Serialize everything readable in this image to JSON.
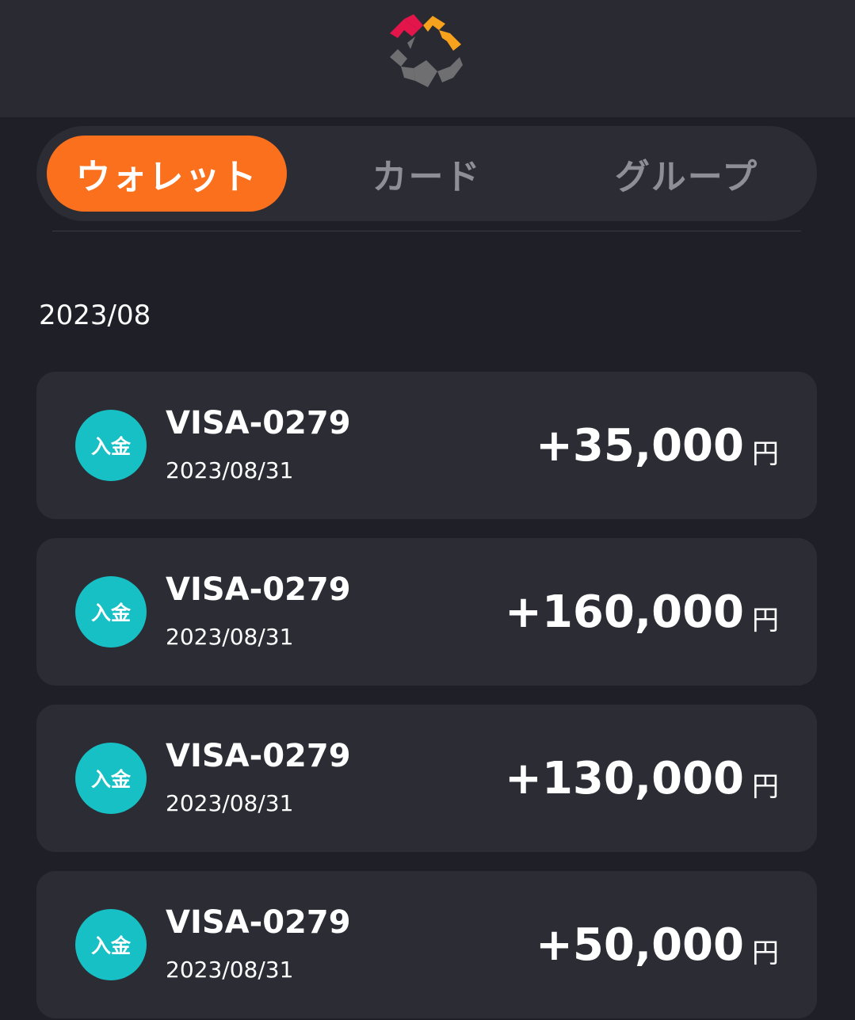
{
  "header": {
    "logo_icon": "brand-logo-icon",
    "logo_colors": [
      "#e3154a",
      "#f7a21c",
      "#6f6f72"
    ]
  },
  "tabs": [
    {
      "label": "ウォレット",
      "active": true
    },
    {
      "label": "カード",
      "active": false
    },
    {
      "label": "グループ",
      "active": false
    }
  ],
  "colors": {
    "accent": "#fb701d",
    "badge": "#16c0c4",
    "background": "#1f2027",
    "card": "#2b2c34"
  },
  "month_label": "2023/08",
  "transactions": [
    {
      "badge": "入金",
      "title": "VISA-0279",
      "date": "2023/08/31",
      "amount": "+35,000",
      "unit": "円"
    },
    {
      "badge": "入金",
      "title": "VISA-0279",
      "date": "2023/08/31",
      "amount": "+160,000",
      "unit": "円"
    },
    {
      "badge": "入金",
      "title": "VISA-0279",
      "date": "2023/08/31",
      "amount": "+130,000",
      "unit": "円"
    },
    {
      "badge": "入金",
      "title": "VISA-0279",
      "date": "2023/08/31",
      "amount": "+50,000",
      "unit": "円"
    }
  ]
}
